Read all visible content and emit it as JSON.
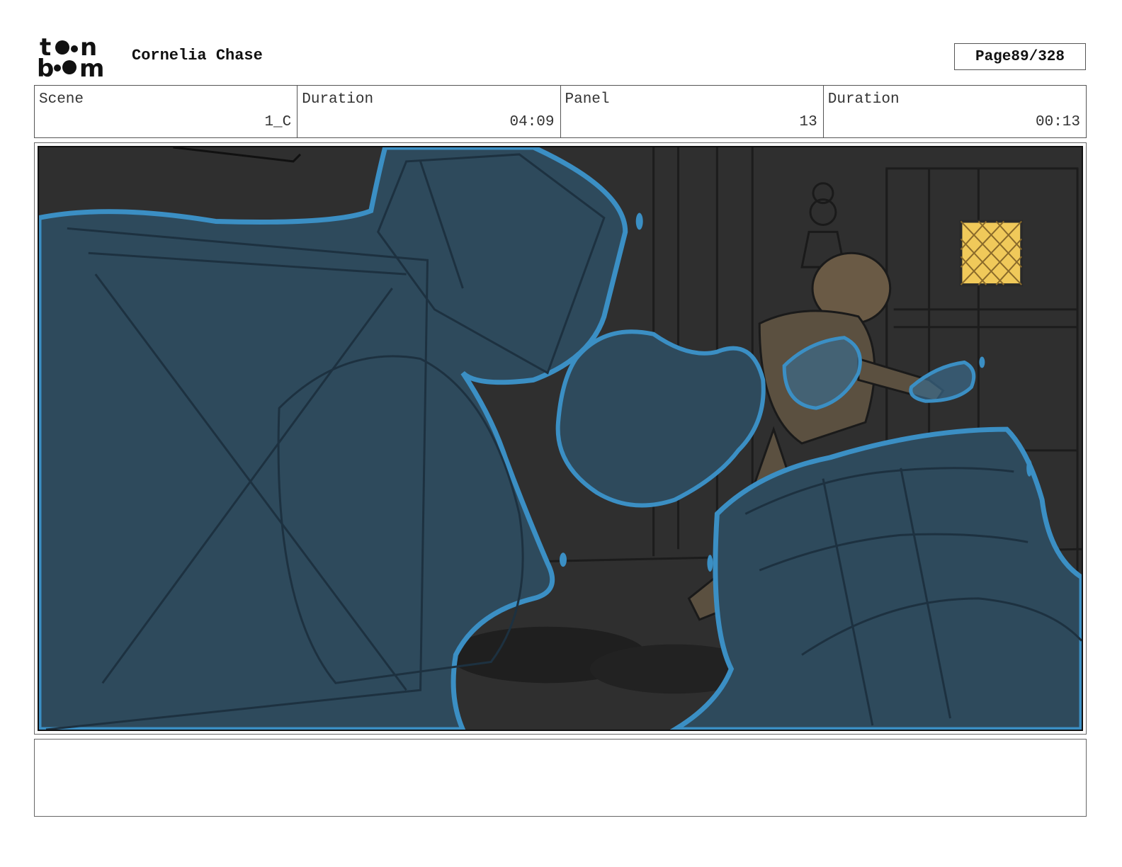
{
  "header": {
    "logo_text": "toon boom",
    "project_title": "Cornelia Chase",
    "page_label": "Page",
    "page_value": "89/328"
  },
  "info": {
    "scene_label": "Scene",
    "scene_value": "1_C",
    "scene_duration_label": "Duration",
    "scene_duration_value": "04:09",
    "panel_label": "Panel",
    "panel_value": "13",
    "panel_duration_label": "Duration",
    "panel_duration_value": "00:13"
  },
  "panel": {
    "image_icon": "storyboard-drawing",
    "colors": {
      "background": "#2f2f2f",
      "water_fill": "#2e4a5c",
      "water_outline": "#3b8fc4",
      "window_glow": "#f0c95a"
    }
  },
  "notes": {
    "text": ""
  }
}
